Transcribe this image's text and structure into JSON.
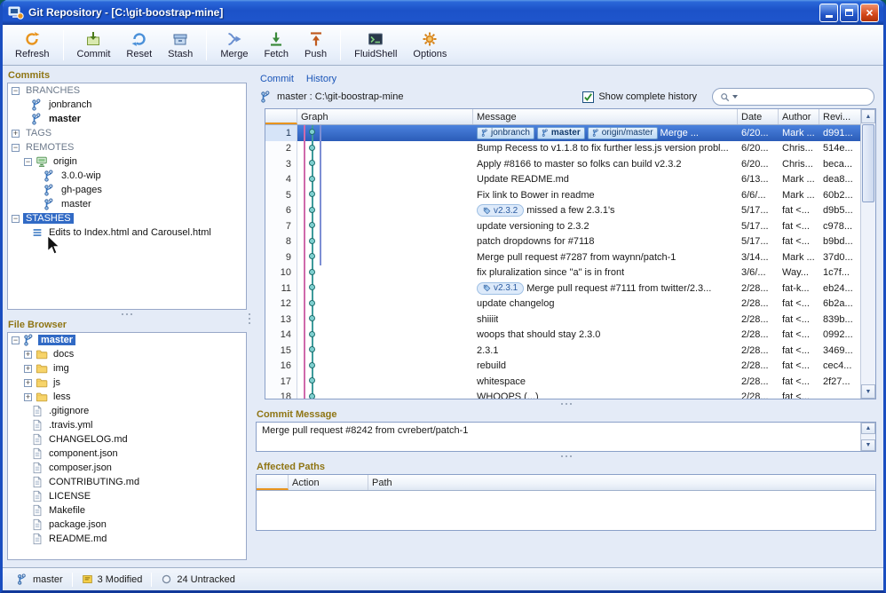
{
  "window": {
    "title": "Git Repository - [C:\\git-boostrap-mine]"
  },
  "toolbar": {
    "items": [
      {
        "label": "Refresh",
        "icon": "refresh-icon",
        "group": 0
      },
      {
        "label": "Commit",
        "icon": "commit-icon",
        "group": 1
      },
      {
        "label": "Reset",
        "icon": "reset-icon",
        "group": 1
      },
      {
        "label": "Stash",
        "icon": "stash-box-icon",
        "group": 1
      },
      {
        "label": "Merge",
        "icon": "merge-icon",
        "group": 2
      },
      {
        "label": "Fetch",
        "icon": "fetch-icon",
        "group": 2
      },
      {
        "label": "Push",
        "icon": "push-icon",
        "group": 2
      },
      {
        "label": "FluidShell",
        "icon": "fluidshell-icon",
        "group": 3
      },
      {
        "label": "Options",
        "icon": "options-icon",
        "group": 3
      }
    ]
  },
  "commits_panel": {
    "title": "Commits",
    "tree": [
      {
        "label": "BRANCHES",
        "level": 0,
        "expander": "minus",
        "section": true
      },
      {
        "label": "jonbranch",
        "level": 1,
        "icon": "branch-icon"
      },
      {
        "label": "master",
        "level": 1,
        "icon": "branch-icon",
        "bold": true
      },
      {
        "label": "TAGS",
        "level": 0,
        "expander": "plus",
        "section": true
      },
      {
        "label": "REMOTES",
        "level": 0,
        "expander": "minus",
        "section": true
      },
      {
        "label": "origin",
        "level": 1,
        "icon": "server-icon",
        "expander": "minus"
      },
      {
        "label": "3.0.0-wip",
        "level": 2,
        "icon": "branch-icon"
      },
      {
        "label": "gh-pages",
        "level": 2,
        "icon": "branch-icon"
      },
      {
        "label": "master",
        "level": 2,
        "icon": "branch-icon"
      },
      {
        "label": "STASHES",
        "level": 0,
        "expander": "minus",
        "section": true,
        "selected": true
      },
      {
        "label": "Edits to Index.html and Carousel.html",
        "level": 1,
        "icon": "stash-icon"
      }
    ]
  },
  "file_browser": {
    "title": "File Browser",
    "tree": [
      {
        "label": "master",
        "level": 0,
        "icon": "branch-icon",
        "expander": "minus",
        "selected": true,
        "bold": true
      },
      {
        "label": "docs",
        "level": 1,
        "icon": "folder-icon",
        "expander": "plus"
      },
      {
        "label": "img",
        "level": 1,
        "icon": "folder-icon",
        "expander": "plus"
      },
      {
        "label": "js",
        "level": 1,
        "icon": "folder-icon",
        "expander": "plus"
      },
      {
        "label": "less",
        "level": 1,
        "icon": "folder-icon",
        "expander": "plus"
      },
      {
        "label": ".gitignore",
        "level": 1,
        "icon": "file-icon"
      },
      {
        "label": ".travis.yml",
        "level": 1,
        "icon": "file-icon"
      },
      {
        "label": "CHANGELOG.md",
        "level": 1,
        "icon": "file-icon"
      },
      {
        "label": "component.json",
        "level": 1,
        "icon": "file-icon"
      },
      {
        "label": "composer.json",
        "level": 1,
        "icon": "file-icon"
      },
      {
        "label": "CONTRIBUTING.md",
        "level": 1,
        "icon": "file-icon"
      },
      {
        "label": "LICENSE",
        "level": 1,
        "icon": "file-icon"
      },
      {
        "label": "Makefile",
        "level": 1,
        "icon": "file-icon"
      },
      {
        "label": "package.json",
        "level": 1,
        "icon": "file-icon"
      },
      {
        "label": "README.md",
        "level": 1,
        "icon": "file-icon"
      }
    ]
  },
  "history": {
    "tabs": [
      {
        "label": "Commit",
        "active": false
      },
      {
        "label": "History",
        "active": true
      }
    ],
    "repo_line": {
      "icon": "branch-icon",
      "text": "master : C:\\git-boostrap-mine"
    },
    "show_history_checkbox": {
      "label": "Show complete history",
      "checked": true
    },
    "search": {
      "placeholder": ""
    },
    "table": {
      "columns": [
        {
          "label": "",
          "key": "num"
        },
        {
          "label": "Graph",
          "key": "graph"
        },
        {
          "label": "Message",
          "key": "msg"
        },
        {
          "label": "Date",
          "key": "date"
        },
        {
          "label": "Author",
          "key": "auth"
        },
        {
          "label": "Revi...",
          "key": "rev"
        }
      ],
      "rows": [
        {
          "num": 1,
          "badges": [
            {
              "label": "jonbranch"
            },
            {
              "label": "master",
              "bold": true
            },
            {
              "label": "origin/master"
            }
          ],
          "message": "Merge ...",
          "date": "6/20...",
          "author": "Mark ...",
          "rev": "d991...",
          "selected": true,
          "dot": 1,
          "lines": [
            [
              0,
              "pink"
            ],
            [
              1,
              "teal"
            ],
            [
              2,
              "blue"
            ]
          ]
        },
        {
          "num": 2,
          "message": "Bump Recess to v1.1.8 to fix further less.js version probl...",
          "date": "6/20...",
          "author": "Chris...",
          "rev": "514e...",
          "dot": 1,
          "lines": [
            [
              0,
              "pink"
            ],
            [
              1,
              "teal"
            ],
            [
              2,
              "blue"
            ]
          ]
        },
        {
          "num": 3,
          "message": "Apply #8166 to master so folks can build v2.3.2",
          "date": "6/20...",
          "author": "Chris...",
          "rev": "beca...",
          "dot": 1,
          "lines": [
            [
              0,
              "pink"
            ],
            [
              1,
              "teal"
            ],
            [
              2,
              "blue"
            ]
          ]
        },
        {
          "num": 4,
          "message": "Update README.md",
          "date": "6/13...",
          "author": "Mark ...",
          "rev": "dea8...",
          "dot": 1,
          "lines": [
            [
              0,
              "pink"
            ],
            [
              1,
              "teal"
            ],
            [
              2,
              "blue"
            ]
          ]
        },
        {
          "num": 5,
          "message": "Fix link to Bower in readme",
          "date": "6/6/...",
          "author": "Mark ...",
          "rev": "60b2...",
          "dot": 1,
          "lines": [
            [
              0,
              "pink"
            ],
            [
              1,
              "teal"
            ],
            [
              2,
              "blue"
            ]
          ]
        },
        {
          "num": 6,
          "tag": {
            "label": "v2.3.2"
          },
          "message": "missed a few 2.3.1's",
          "date": "5/17...",
          "author": "fat <...",
          "rev": "d9b5...",
          "dot": 1,
          "lines": [
            [
              0,
              "pink"
            ],
            [
              1,
              "teal"
            ],
            [
              2,
              "blue"
            ]
          ]
        },
        {
          "num": 7,
          "message": "update versioning to 2.3.2",
          "date": "5/17...",
          "author": "fat <...",
          "rev": "c978...",
          "dot": 1,
          "lines": [
            [
              0,
              "pink"
            ],
            [
              1,
              "teal"
            ],
            [
              2,
              "blue"
            ]
          ]
        },
        {
          "num": 8,
          "message": "patch dropdowns for #7118",
          "date": "5/17...",
          "author": "fat <...",
          "rev": "b9bd...",
          "dot": 1,
          "lines": [
            [
              0,
              "pink"
            ],
            [
              1,
              "teal"
            ],
            [
              2,
              "blue"
            ]
          ]
        },
        {
          "num": 9,
          "message": "Merge pull request #7287 from waynn/patch-1",
          "date": "3/14...",
          "author": "Mark ...",
          "rev": "37d0...",
          "dot": 1,
          "lines": [
            [
              0,
              "pink"
            ],
            [
              1,
              "teal"
            ],
            [
              2,
              "blue"
            ]
          ]
        },
        {
          "num": 10,
          "message": "fix pluralization since \"a\" is in front",
          "date": "3/6/...",
          "author": "Way...",
          "rev": "1c7f...",
          "dot": 1,
          "lines": [
            [
              0,
              "pink"
            ],
            [
              1,
              "teal"
            ]
          ]
        },
        {
          "num": 11,
          "tag": {
            "label": "v2.3.1"
          },
          "message": "Merge pull request #7111 from twitter/2.3...",
          "date": "2/28...",
          "author": "fat-k...",
          "rev": "eb24...",
          "dot": 1,
          "lines": [
            [
              0,
              "pink"
            ],
            [
              1,
              "teal"
            ]
          ]
        },
        {
          "num": 12,
          "message": "update changelog",
          "date": "2/28...",
          "author": "fat <...",
          "rev": "6b2a...",
          "dot": 1,
          "lines": [
            [
              0,
              "pink"
            ],
            [
              1,
              "teal"
            ]
          ]
        },
        {
          "num": 13,
          "message": "shiiiit",
          "date": "2/28...",
          "author": "fat <...",
          "rev": "839b...",
          "dot": 1,
          "lines": [
            [
              0,
              "pink"
            ],
            [
              1,
              "teal"
            ]
          ]
        },
        {
          "num": 14,
          "message": "woops that should stay 2.3.0",
          "date": "2/28...",
          "author": "fat <...",
          "rev": "0992...",
          "dot": 1,
          "lines": [
            [
              0,
              "pink"
            ],
            [
              1,
              "teal"
            ]
          ]
        },
        {
          "num": 15,
          "message": "2.3.1",
          "date": "2/28...",
          "author": "fat <...",
          "rev": "3469...",
          "dot": 1,
          "lines": [
            [
              0,
              "pink"
            ],
            [
              1,
              "teal"
            ]
          ]
        },
        {
          "num": 16,
          "message": "rebuild",
          "date": "2/28...",
          "author": "fat <...",
          "rev": "cec4...",
          "dot": 1,
          "lines": [
            [
              0,
              "pink"
            ],
            [
              1,
              "teal"
            ]
          ]
        },
        {
          "num": 17,
          "message": "whitespace",
          "date": "2/28...",
          "author": "fat <...",
          "rev": "2f27...",
          "dot": 1,
          "lines": [
            [
              0,
              "pink"
            ],
            [
              1,
              "teal"
            ]
          ]
        },
        {
          "num": 18,
          "message": "WHOOPS (...)",
          "date": "2/28...",
          "author": "fat <...",
          "rev": "",
          "dot": 1,
          "lines": [
            [
              0,
              "pink"
            ],
            [
              1,
              "teal"
            ]
          ]
        }
      ]
    }
  },
  "commit_message": {
    "title": "Commit Message",
    "text": "Merge pull request #8242 from cvrebert/patch-1"
  },
  "affected_paths": {
    "title": "Affected Paths",
    "columns": [
      {
        "label": ""
      },
      {
        "label": "Action"
      },
      {
        "label": "Path"
      }
    ]
  },
  "status_bar": {
    "items": [
      {
        "icon": "branch-icon",
        "label": "master"
      },
      {
        "icon": "modified-icon",
        "label": "3 Modified"
      },
      {
        "icon": "untracked-icon",
        "label": "24 Untracked"
      }
    ]
  },
  "colors": {
    "selection": "#316ac5",
    "accent_orange": "#e8941e",
    "graph": {
      "pink": "#cf6aab",
      "teal": "#3d9b9b",
      "blue": "#7d8fd4"
    }
  }
}
